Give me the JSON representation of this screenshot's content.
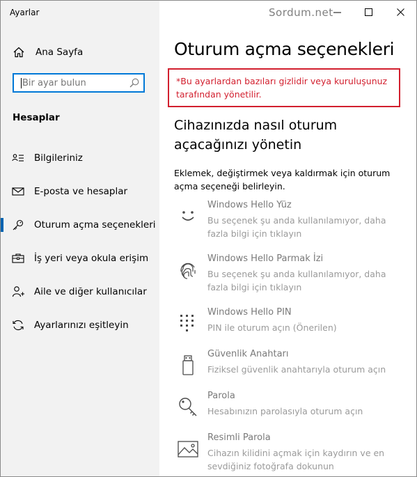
{
  "window": {
    "title": "Ayarlar",
    "watermark": "Sordum.net"
  },
  "sidebar": {
    "home_label": "Ana Sayfa",
    "search": {
      "placeholder": "Bir ayar bulun"
    },
    "section_title": "Hesaplar",
    "items": [
      {
        "label": "Bilgileriniz",
        "icon": "person-card-icon",
        "selected": false
      },
      {
        "label": "E-posta ve hesaplar",
        "icon": "mail-icon",
        "selected": false
      },
      {
        "label": "Oturum açma seçenekleri",
        "icon": "key-icon",
        "selected": true
      },
      {
        "label": "İş yeri veya okula erişim",
        "icon": "briefcase-icon",
        "selected": false
      },
      {
        "label": "Aile ve diğer kullanıcılar",
        "icon": "add-person-icon",
        "selected": false
      },
      {
        "label": "Ayarlarınızı eşitleyin",
        "icon": "sync-icon",
        "selected": false
      }
    ]
  },
  "main": {
    "title": "Oturum açma seçenekleri",
    "policy_notice": "*Bu ayarlardan bazıları gizlidir veya kuruluşunuz tarafından yönetilir.",
    "heading": "Cihazınızda nasıl oturum açacağınızı yönetin",
    "description": "Eklemek, değiştirmek veya kaldırmak için oturum açma seçeneği belirleyin.",
    "options": [
      {
        "title": "Windows Hello Yüz",
        "subtitle": "Bu seçenek şu anda kullanılamıyor, daha fazla bilgi için tıklayın",
        "icon": "smiley-face-icon"
      },
      {
        "title": "Windows Hello Parmak İzi",
        "subtitle": "Bu seçenek şu anda kullanılamıyor, daha fazla bilgi için tıklayın",
        "icon": "fingerprint-icon"
      },
      {
        "title": "Windows Hello PIN",
        "subtitle": "PIN ile oturum açın (Önerilen)",
        "icon": "pin-keypad-icon"
      },
      {
        "title": "Güvenlik Anahtarı",
        "subtitle": "Fiziksel güvenlik anahtarıyla oturum açın",
        "icon": "usb-key-icon"
      },
      {
        "title": "Parola",
        "subtitle": "Hesabınızın parolasıyla oturum açın",
        "icon": "password-key-icon"
      },
      {
        "title": "Resimli Parola",
        "subtitle": "Cihazın kilidini açmak için kaydırın ve en sevdiğiniz fotoğrafa dokunun",
        "icon": "picture-icon"
      }
    ]
  },
  "colors": {
    "accent": "#0078d7",
    "selection_bar": "#0063b1",
    "policy_red": "#d21f2e",
    "sidebar_bg": "#f2f2f2"
  }
}
